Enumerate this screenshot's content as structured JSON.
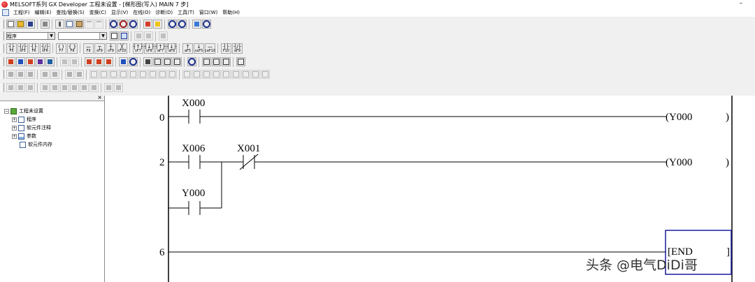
{
  "window": {
    "title": "MELSOFT系列 GX Developer 工程未设置 - [梯形图(写入)    MAIN    7 步]",
    "minimize": "–"
  },
  "menu": [
    "工程(F)",
    "编辑(E)",
    "查找/替换(S)",
    "变换(C)",
    "显示(V)",
    "在线(O)",
    "诊断(D)",
    "工具(T)",
    "窗口(W)",
    "帮助(H)"
  ],
  "toolbar": {
    "data_type_select": "程序",
    "device_select": "",
    "dropdown_arrow": "▼"
  },
  "fkeys": [
    {
      "sym": "┤├",
      "key": "F5"
    },
    {
      "sym": "┤/├",
      "key": "sF5"
    },
    {
      "sym": "┤├",
      "key": "F6"
    },
    {
      "sym": "┤/├",
      "key": "sF6"
    },
    {
      "sym": "( )",
      "key": "F7"
    },
    {
      "sym": "{ }",
      "key": "F8"
    },
    {
      "sym": "—",
      "key": "F9"
    },
    {
      "sym": "┬",
      "key": "sF9"
    },
    {
      "sym": "┼",
      "key": "cF9"
    },
    {
      "sym": "╳",
      "key": "cF10"
    },
    {
      "sym": "┤↑├",
      "key": "sF7"
    },
    {
      "sym": "┤↓├",
      "key": "sF8"
    },
    {
      "sym": "┤↑├",
      "key": "aF7"
    },
    {
      "sym": "┤↓├",
      "key": "aF8"
    },
    {
      "sym": "↑",
      "key": "aF5"
    },
    {
      "sym": "↓",
      "key": "caF5"
    },
    {
      "sym": "—",
      "key": "caF10"
    },
    {
      "sym": "┤├",
      "key": "F10"
    },
    {
      "sym": "┤/├",
      "key": "aF9"
    }
  ],
  "project_tree": {
    "close": "×",
    "root": "工程未设置",
    "items": [
      {
        "label": "程序",
        "expander": "+"
      },
      {
        "label": "软元件注释",
        "expander": "+"
      },
      {
        "label": "参数",
        "expander": "+"
      },
      {
        "label": "软元件内存",
        "expander": ""
      }
    ],
    "root_expander": "−"
  },
  "ladder": {
    "rungs": [
      {
        "step": "0",
        "contact1": "X000",
        "coil": "(Y000",
        "coil_end": ")"
      },
      {
        "step": "2",
        "contact1": "X006",
        "contact2": "X001",
        "branch_contact": "Y000",
        "coil": "(Y000",
        "coil_end": ")"
      },
      {
        "step": "6",
        "end_label": "[END",
        "end_close": "]"
      }
    ]
  },
  "watermark": "头条 @电气DiDi哥",
  "colors": {
    "rail": "#000000",
    "cursor": "#1a1aa0",
    "panel_bg": "#ffffff",
    "chrome": "#f0f0f0"
  }
}
